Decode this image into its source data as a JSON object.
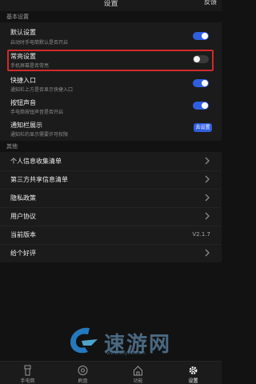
{
  "header": {
    "title": "设置",
    "right_link": "反馈"
  },
  "sections": {
    "basic": "基本设置",
    "other": "其他"
  },
  "settings": [
    {
      "title": "默认设置",
      "desc": "启动时手电筒默认是否开启",
      "control": "toggle",
      "state": "on"
    },
    {
      "title": "常亮设置",
      "desc": "手机屏幕是否常亮",
      "control": "toggle",
      "state": "off"
    },
    {
      "title": "快捷入口",
      "desc": "通知栏上方是否显示快捷入口",
      "control": "toggle",
      "state": "on"
    },
    {
      "title": "按钮声音",
      "desc": "手电筒按钮声音是否开启",
      "control": "toggle",
      "state": "on"
    },
    {
      "title": "通知栏展示",
      "desc": "通知栏的显示需要许可权限",
      "control": "button",
      "button_label": "去设置"
    }
  ],
  "other_items": [
    {
      "label": "个人信息收集清单"
    },
    {
      "label": "第三方共享信息清单"
    },
    {
      "label": "隐私政策"
    },
    {
      "label": "用户协议"
    },
    {
      "label": "当前版本",
      "value": "V2.1.7"
    },
    {
      "label": "给个好评"
    }
  ],
  "watermark": {
    "text": "速游网",
    "url": "www.suyou.com"
  },
  "bottom_nav": [
    {
      "label": "手电筒",
      "icon": "flashlight-icon",
      "active": false
    },
    {
      "label": "刷盘",
      "icon": "dial-icon",
      "active": false
    },
    {
      "label": "功能",
      "icon": "home-icon",
      "active": false
    },
    {
      "label": "设置",
      "icon": "gear-icon",
      "active": true
    }
  ],
  "colors": {
    "background": "#121212",
    "card": "#1b1b1b",
    "accent": "#2f5fe0",
    "highlight_border": "#d12a2a"
  }
}
